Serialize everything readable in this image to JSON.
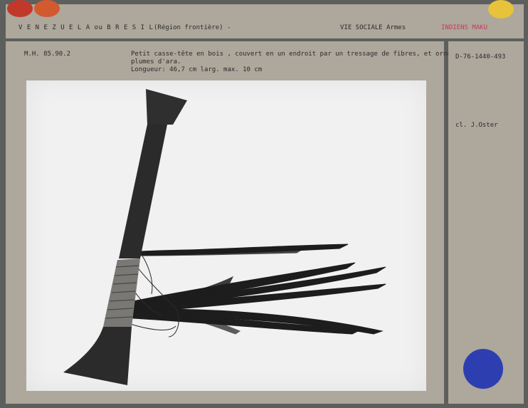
{
  "header": {
    "country": "V E N E Z U E L A   ou   B R E S I L",
    "region": "(Région frontière) -",
    "category": "VIE SOCIALE  Armes",
    "people": "INDIENS MAKU"
  },
  "record": {
    "inventory": "M.H. 85.90.2",
    "description_line1": "Petit casse-tête en bois , couvert en un endroit par un tressage de fibres, et orné de",
    "description_line2": "plumes d'ara.",
    "dimensions": "Longueur: 46,7 cm  larg. max. 10 cm"
  },
  "side": {
    "photo_ref": "D-76-1440-493",
    "credit": "cl. J.Oster"
  },
  "colors": {
    "card": "#ada79c",
    "red_dot": "#c0392b",
    "orange_dot": "#d35a2e",
    "yellow_dot": "#e8c23a",
    "blue_dot": "#2d3fb0",
    "people_text": "#c73a5a"
  }
}
